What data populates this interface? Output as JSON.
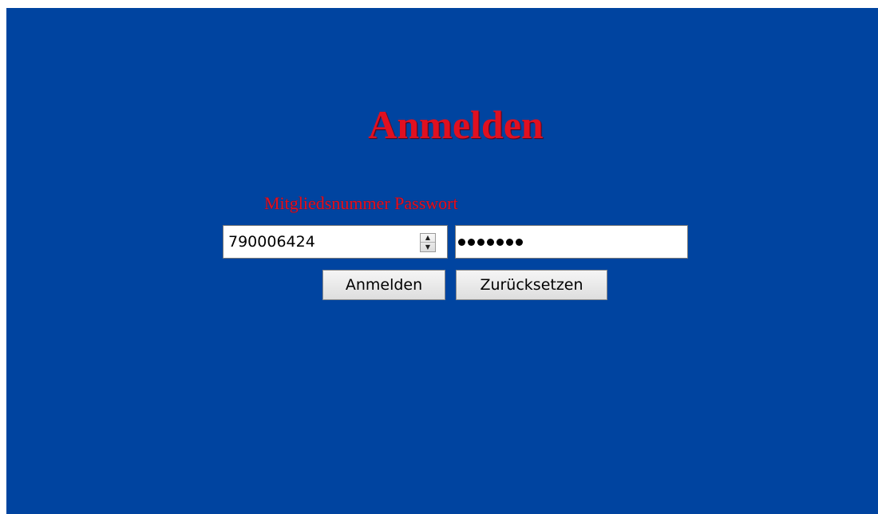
{
  "form": {
    "title": "Anmelden",
    "labels": {
      "member_number": "Mitgliedsnummer",
      "password": "Passwort"
    },
    "member_number_value": "790006424",
    "password_masked_length": 7,
    "submit_label": "Anmelden",
    "reset_label": "Zurücksetzen"
  },
  "colors": {
    "background": "#0044a0",
    "heading": "#e01020"
  }
}
